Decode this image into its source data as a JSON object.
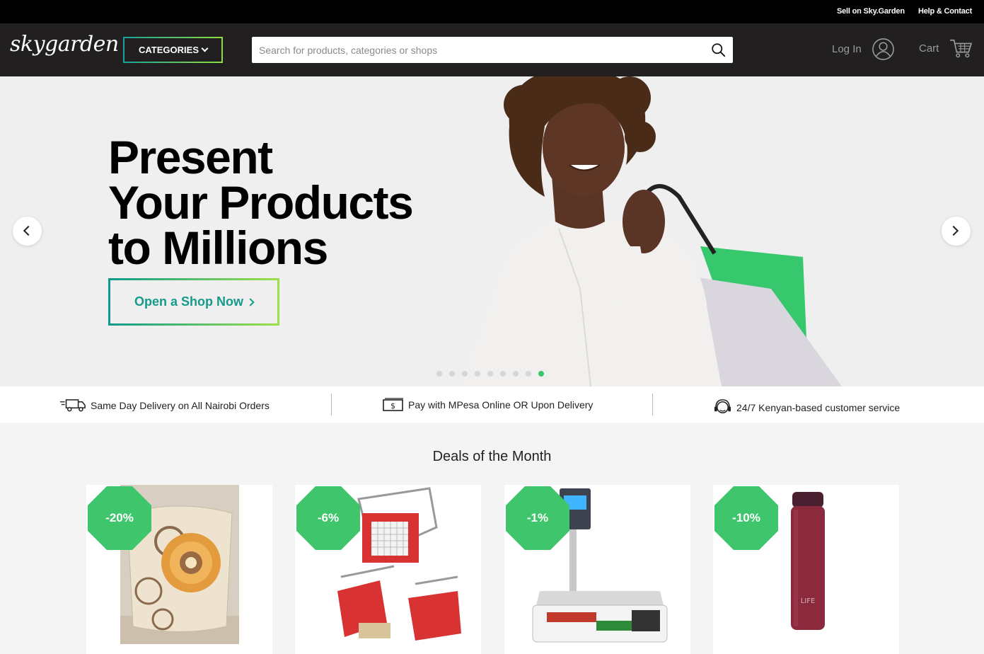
{
  "topbar": {
    "sell": "Sell on Sky.Garden",
    "help": "Help & Contact"
  },
  "header": {
    "logo": "skygarden",
    "categories_label": "CATEGORIES",
    "search_placeholder": "Search for products, categories or shops",
    "login_label": "Log In",
    "cart_label": "Cart"
  },
  "hero": {
    "title_lines": [
      "Present",
      "Your Products",
      "to Millions"
    ],
    "cta_label": "Open a Shop Now",
    "slide_count": 9,
    "active_slide": 9
  },
  "features": [
    {
      "icon": "delivery-truck-icon",
      "text": "Same Day Delivery on All Nairobi Orders"
    },
    {
      "icon": "money-icon",
      "text": "Pay with MPesa Online OR Upon Delivery"
    },
    {
      "icon": "customer-service-icon",
      "text": "24/7 Kenyan-based customer service"
    }
  ],
  "deals": {
    "title": "Deals of the Month",
    "items": [
      {
        "discount": "-20%",
        "image": "cushion"
      },
      {
        "discount": "-6%",
        "image": "vegetable-cutter"
      },
      {
        "discount": "-1%",
        "image": "digital-scale"
      },
      {
        "discount": "-10%",
        "image": "thermos-bottle",
        "label": "LIFE"
      }
    ]
  },
  "colors": {
    "accent_green": "#3fc66c",
    "teal": "#159a8a",
    "header_bg": "#221f20",
    "topbar_bg": "#000000"
  }
}
